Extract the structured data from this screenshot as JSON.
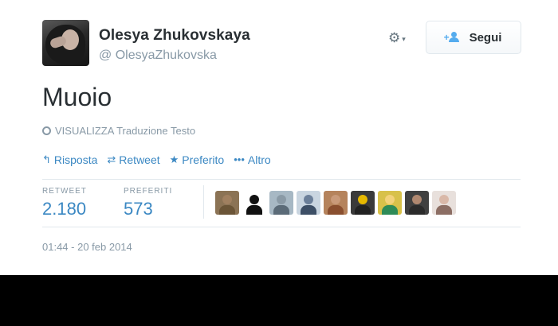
{
  "author": {
    "name": "Olesya Zhukovskaya",
    "handle": "@ OlesyaZhukovska"
  },
  "header": {
    "follow_label": "Segui",
    "gear_icon": "gear-icon"
  },
  "tweet": {
    "text": "Muoio",
    "translate_label": "VISUALIZZA Traduzione Testo"
  },
  "actions": [
    {
      "label": "Risposta",
      "icon": "reply-icon"
    },
    {
      "label": "Retweet",
      "icon": "retweet-icon"
    },
    {
      "label": "Preferito",
      "icon": "star-icon"
    },
    {
      "label": "Altro",
      "icon": "more-icon"
    }
  ],
  "stats": {
    "retweets_label": "RETWEET",
    "retweets_value": "2.180",
    "favorites_label": "PREFERITI",
    "favorites_value": "573"
  },
  "faces": [
    {
      "head": "#a08060",
      "body": "#6b5537",
      "bg": "#8b7355"
    },
    {
      "head": "#111111",
      "body": "#111111",
      "bg": "#ffffff"
    },
    {
      "head": "#8a9aa6",
      "body": "#5b6b78",
      "bg": "#a7b8c4"
    },
    {
      "head": "#6b7f99",
      "body": "#3d4f66",
      "bg": "#c9d5e0"
    },
    {
      "head": "#c99a7a",
      "body": "#8a4f2f",
      "bg": "#b5835c"
    },
    {
      "head": "#e6b800",
      "body": "#222222",
      "bg": "#3a3a3a"
    },
    {
      "head": "#f3d27a",
      "body": "#2e8b57",
      "bg": "#d8c14a"
    },
    {
      "head": "#b08870",
      "body": "#2b2b2b",
      "bg": "#404040"
    },
    {
      "head": "#d9b8a8",
      "body": "#8c6e64",
      "bg": "#e8e0dc"
    }
  ],
  "timestamp": "01:44 - 20 feb 2014",
  "colors": {
    "link": "#3b88c3",
    "muted": "#8899a6",
    "text": "#292f33"
  }
}
